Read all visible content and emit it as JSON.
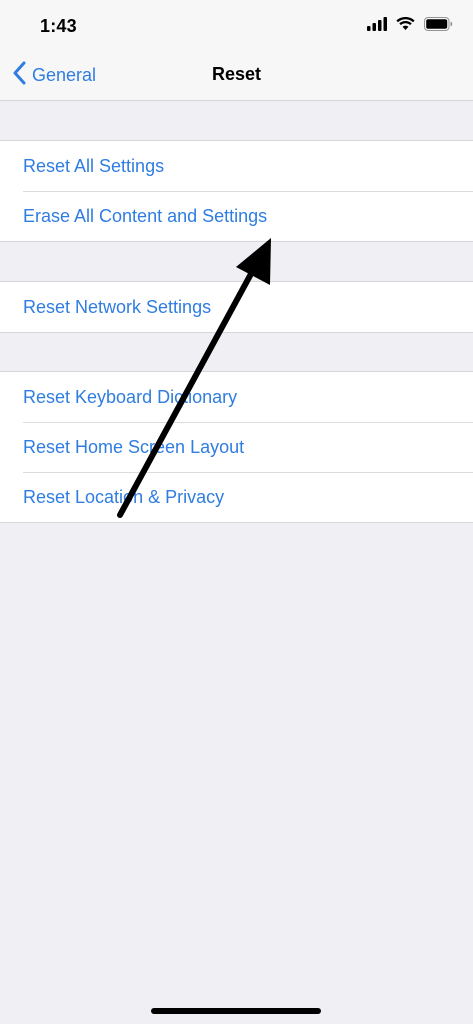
{
  "status_bar": {
    "time": "1:43",
    "icons": [
      "signal-bars-icon",
      "wifi-icon",
      "battery-icon"
    ]
  },
  "nav": {
    "back_label": "General",
    "back_icon": "chevron-left-icon",
    "title": "Reset"
  },
  "groups": [
    {
      "items": [
        {
          "label": "Reset All Settings"
        },
        {
          "label": "Erase All Content and Settings"
        }
      ]
    },
    {
      "items": [
        {
          "label": "Reset Network Settings"
        }
      ]
    },
    {
      "items": [
        {
          "label": "Reset Keyboard Dictionary"
        },
        {
          "label": "Reset Home Screen Layout"
        },
        {
          "label": "Reset Location & Privacy"
        }
      ]
    }
  ],
  "annotation": {
    "icon": "arrow-annotation-icon",
    "color": "#000000",
    "points_to": "Erase All Content and Settings"
  },
  "colors": {
    "accent": "#2f7de1",
    "background": "#efeff4",
    "cell": "#ffffff",
    "bars": "#f7f7f7"
  }
}
